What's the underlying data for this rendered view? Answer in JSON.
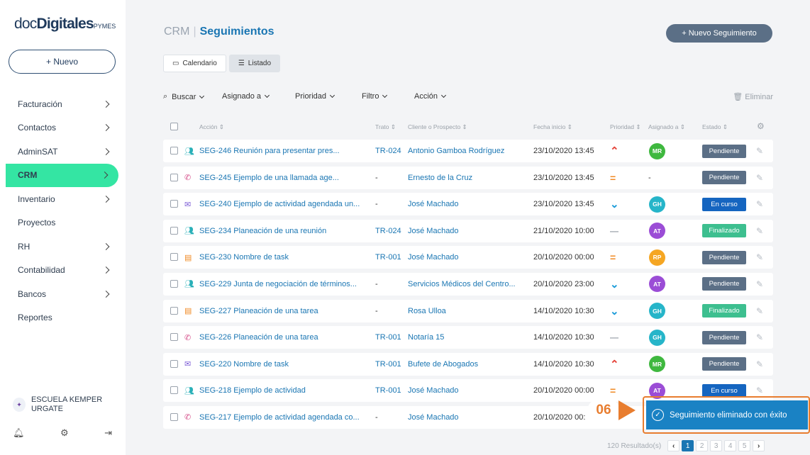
{
  "brand": {
    "part1": "doc",
    "part2": "Digitales",
    "part3": "PYMES"
  },
  "sidebar": {
    "new_label": "+ Nuevo",
    "items": [
      {
        "label": "Facturación",
        "chevron": true,
        "active": false
      },
      {
        "label": "Contactos",
        "chevron": true,
        "active": false
      },
      {
        "label": "AdminSAT",
        "chevron": true,
        "active": false
      },
      {
        "label": "CRM",
        "chevron": true,
        "active": true
      },
      {
        "label": "Inventario",
        "chevron": true,
        "active": false
      },
      {
        "label": "Proyectos",
        "chevron": false,
        "active": false
      },
      {
        "label": "RH",
        "chevron": true,
        "active": false
      },
      {
        "label": "Contabilidad",
        "chevron": true,
        "active": false
      },
      {
        "label": "Bancos",
        "chevron": true,
        "active": false
      },
      {
        "label": "Reportes",
        "chevron": false,
        "active": false
      }
    ],
    "school": "ESCUELA KEMPER URGATE",
    "footer_icons": [
      "notification-icon",
      "settings-icon",
      "logout-icon"
    ]
  },
  "header": {
    "module": "CRM",
    "separator": "|",
    "section": "Seguimientos",
    "new_button": "+ Nuevo Seguimiento"
  },
  "views": {
    "calendar": "Calendario",
    "list": "Listado",
    "active": "list"
  },
  "toolbar": {
    "search": "Buscar",
    "assigned": "Asignado a",
    "priority": "Prioridad",
    "filter": "Filtro",
    "action": "Acción",
    "delete": "Eliminar"
  },
  "columns": [
    "Acción",
    "Trato",
    "Cliente o Prospecto",
    "Fecha inicio",
    "Prioridad",
    "Asignado a",
    "Estado"
  ],
  "colors": {
    "accent": "#1a76b3",
    "active_nav": "#34e5a3",
    "pendiente": "#5b6f86",
    "en_curso": "#1565c0",
    "finalizado": "#3dbf8f",
    "highlight": "#e87d2f",
    "toast": "#1a82c4"
  },
  "rows": [
    {
      "type": "meeting",
      "accion": "SEG-246 Reunión para presentar pres...",
      "trato": "TR-024",
      "cliente": "Antonio Gamboa Rodríguez",
      "fecha": "23/10/2020 13:45",
      "prioridad": "high",
      "asignado": "MR",
      "avatar_color": "#3fb83f",
      "estado": "Pendiente"
    },
    {
      "type": "call",
      "accion": "SEG-245 Ejemplo de una llamada age...",
      "trato": "-",
      "cliente": "Ernesto de la Cruz",
      "fecha": "23/10/2020 13:45",
      "prioridad": "medium",
      "asignado": "-",
      "avatar_color": "",
      "estado": "Pendiente"
    },
    {
      "type": "email",
      "accion": "SEG-240 Ejemplo de actividad agendada un...",
      "trato": "-",
      "cliente": "José Machado",
      "fecha": "23/10/2020 13:45",
      "prioridad": "low",
      "asignado": "GH",
      "avatar_color": "#26b5c9",
      "estado": "En curso"
    },
    {
      "type": "meeting",
      "accion": "SEG-234 Planeación de una reunión",
      "trato": "TR-024",
      "cliente": "José Machado",
      "fecha": "21/10/2020 10:00",
      "prioridad": "none",
      "asignado": "AT",
      "avatar_color": "#9b4dd6",
      "estado": "Finalizado"
    },
    {
      "type": "task",
      "accion": "SEG-230 Nombre de task",
      "trato": "TR-001",
      "cliente": "José Machado",
      "fecha": "20/10/2020 00:00",
      "prioridad": "medium",
      "asignado": "RP",
      "avatar_color": "#f5a623",
      "estado": "Pendiente"
    },
    {
      "type": "meeting",
      "accion": "SEG-229 Junta de negociación de términos...",
      "trato": "-",
      "cliente": "Servicios Médicos del Centro...",
      "fecha": "20/10/2020 23:00",
      "prioridad": "low",
      "asignado": "AT",
      "avatar_color": "#9b4dd6",
      "estado": "Pendiente"
    },
    {
      "type": "task",
      "accion": "SEG-227 Planeación de una tarea",
      "trato": "-",
      "cliente": "Rosa Ulloa",
      "fecha": "14/10/2020 10:30",
      "prioridad": "low",
      "asignado": "GH",
      "avatar_color": "#26b5c9",
      "estado": "Finalizado"
    },
    {
      "type": "call",
      "accion": "SEG-226 Planeación de una tarea",
      "trato": "TR-001",
      "cliente": "Notaría 15",
      "fecha": "14/10/2020 10:30",
      "prioridad": "none",
      "asignado": "GH",
      "avatar_color": "#26b5c9",
      "estado": "Pendiente"
    },
    {
      "type": "email",
      "accion": "SEG-220 Nombre de task",
      "trato": "TR-001",
      "cliente": "Bufete de Abogados",
      "fecha": "14/10/2020 10:30",
      "prioridad": "high",
      "asignado": "MR",
      "avatar_color": "#3fb83f",
      "estado": "Pendiente"
    },
    {
      "type": "meeting",
      "accion": "SEG-218 Ejemplo de actividad",
      "trato": "TR-001",
      "cliente": "José Machado",
      "fecha": "20/10/2020 00:00",
      "prioridad": "medium",
      "asignado": "AT",
      "avatar_color": "#9b4dd6",
      "estado": "En curso"
    },
    {
      "type": "call",
      "accion": "SEG-217 Ejemplo de actividad agendada co...",
      "trato": "-",
      "cliente": "José Machado",
      "fecha": "20/10/2020 00:",
      "prioridad": "",
      "asignado": "",
      "avatar_color": "",
      "estado": ""
    }
  ],
  "pagination": {
    "results": "120 Resultado(s)",
    "pages": [
      "1",
      "2",
      "3",
      "4",
      "5"
    ],
    "current": "1"
  },
  "toast": {
    "message": "Seguimiento eliminado con éxito"
  },
  "step_marker": "06"
}
